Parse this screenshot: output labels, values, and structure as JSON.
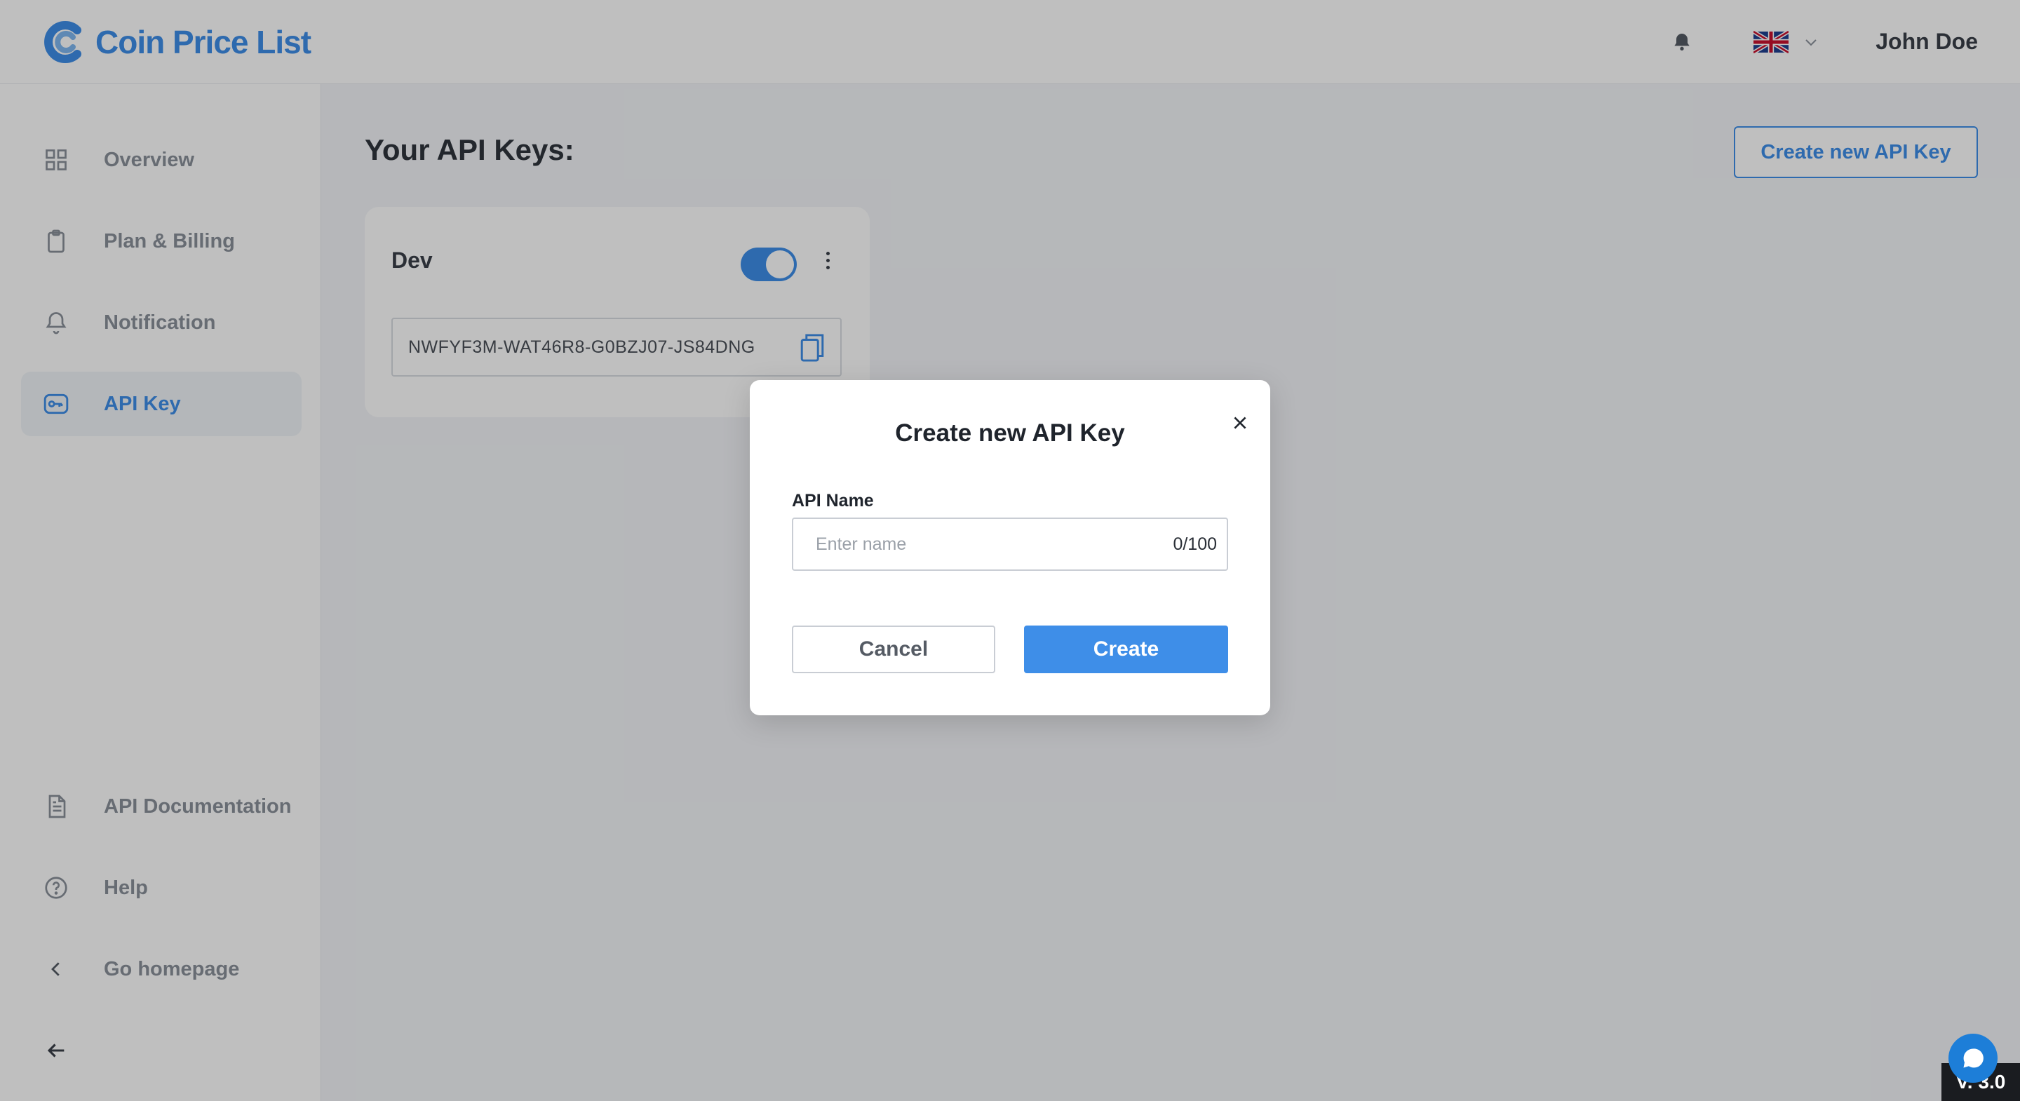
{
  "header": {
    "logo_text": "Coin Price List",
    "user_name": "John Doe",
    "language_flag": "uk-flag-icon"
  },
  "sidebar": {
    "items": [
      {
        "label": "Overview",
        "icon": "grid-icon"
      },
      {
        "label": "Plan & Billing",
        "icon": "clipboard-icon"
      },
      {
        "label": "Notification",
        "icon": "bell-icon"
      },
      {
        "label": "API Key",
        "icon": "key-icon",
        "active": true
      },
      {
        "label": "API Documentation",
        "icon": "document-icon"
      },
      {
        "label": "Help",
        "icon": "help-icon"
      },
      {
        "label": "Go homepage",
        "icon": "chevron-left-icon"
      }
    ],
    "collapse_icon": "arrow-left-icon"
  },
  "main": {
    "title": "Your API Keys:",
    "create_button": "Create new API Key",
    "api_keys": [
      {
        "name": "Dev",
        "enabled": true,
        "key": "NWFYF3M-WAT46R8-G0BZJ07-JS84DNG"
      }
    ]
  },
  "modal": {
    "title": "Create new API Key",
    "field_label": "API Name",
    "placeholder": "Enter name",
    "value": "",
    "counter": "0/100",
    "cancel_label": "Cancel",
    "create_label": "Create"
  },
  "footer": {
    "version": "V. 3.0"
  },
  "colors": {
    "accent": "#3e8ee8",
    "overlay": "rgba(0,0,0,0.25)"
  }
}
